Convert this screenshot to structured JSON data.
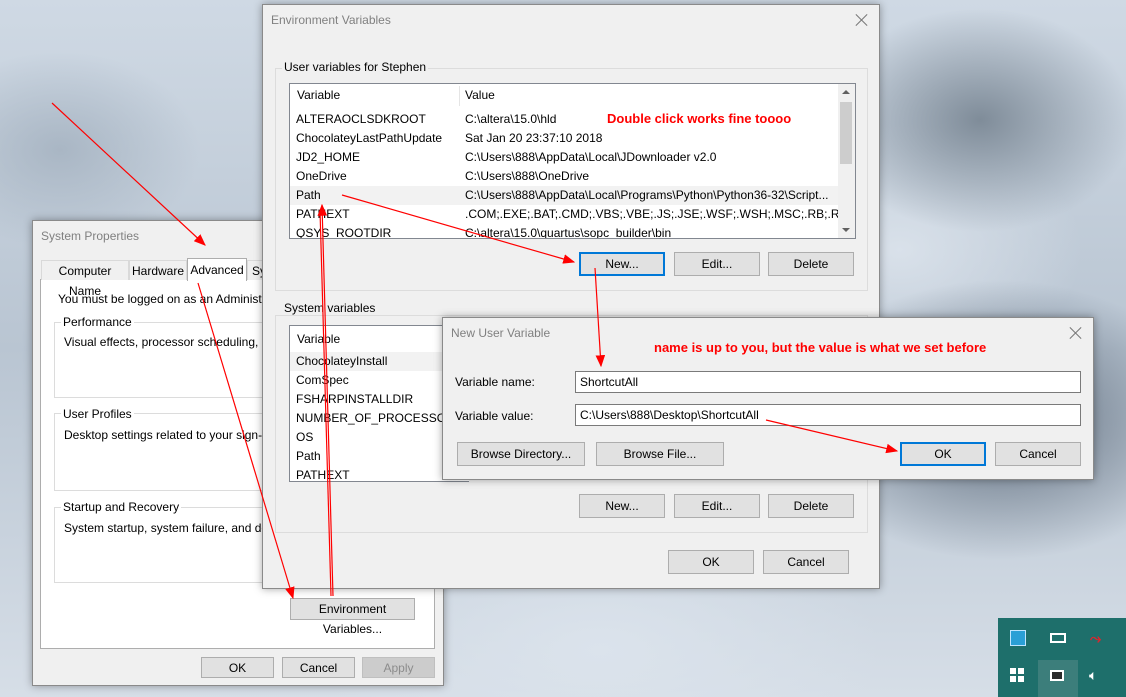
{
  "system_properties": {
    "title": "System Properties",
    "tabs": [
      "Computer Name",
      "Hardware",
      "Advanced",
      "Sy"
    ],
    "active_tab": "Advanced",
    "admin_note": "You must be logged on as an Administrator t",
    "performance": {
      "label": "Performance",
      "text": "Visual effects, processor scheduling, memo"
    },
    "user_profiles": {
      "label": "User Profiles",
      "text": "Desktop settings related to your sign-in"
    },
    "startup_recovery": {
      "label": "Startup and Recovery",
      "text": "System startup, system failure, and debugg"
    },
    "env_button": "Environment Variables...",
    "ok": "OK",
    "cancel": "Cancel",
    "apply": "Apply"
  },
  "env_vars": {
    "title": "Environment Variables",
    "user_group_label": "User variables for Stephen",
    "columns": [
      "Variable",
      "Value"
    ],
    "user_vars": [
      {
        "name": "ALTERAOCLSDKROOT",
        "value": "C:\\altera\\15.0\\hld"
      },
      {
        "name": "ChocolateyLastPathUpdate",
        "value": "Sat Jan 20 23:37:10 2018"
      },
      {
        "name": "JD2_HOME",
        "value": "C:\\Users\\888\\AppData\\Local\\JDownloader v2.0"
      },
      {
        "name": "OneDrive",
        "value": "C:\\Users\\888\\OneDrive"
      },
      {
        "name": "Path",
        "value": "C:\\Users\\888\\AppData\\Local\\Programs\\Python\\Python36-32\\Script..."
      },
      {
        "name": "PATHEXT",
        "value": ".COM;.EXE;.BAT;.CMD;.VBS;.VBE;.JS;.JSE;.WSF;.WSH;.MSC;.RB;.RBW;..."
      },
      {
        "name": "QSYS_ROOTDIR",
        "value": "C:\\altera\\15.0\\quartus\\sopc_builder\\bin"
      }
    ],
    "user_new": "New...",
    "user_edit": "Edit...",
    "user_delete": "Delete",
    "system_group_label": "System variables",
    "system_vars": [
      "ChocolateyInstall",
      "ComSpec",
      "FSHARPINSTALLDIR",
      "NUMBER_OF_PROCESSORS",
      "OS",
      "Path",
      "PATHEXT"
    ],
    "sys_new": "New...",
    "sys_edit": "Edit...",
    "sys_delete": "Delete",
    "ok": "OK",
    "cancel": "Cancel"
  },
  "new_user_var": {
    "title": "New User Variable",
    "name_label": "Variable name:",
    "name_value": "ShortcutAll",
    "value_label": "Variable value:",
    "value_value": "C:\\Users\\888\\Desktop\\ShortcutAll",
    "browse_dir": "Browse Directory...",
    "browse_file": "Browse File...",
    "ok": "OK",
    "cancel": "Cancel"
  },
  "annotations": {
    "double_click": "Double click works fine toooo",
    "name_note": "name is up to you, but the value is what we set before",
    "color": "#ff0000"
  },
  "tray": {
    "icons": [
      "app-icon",
      "battery-icon",
      "network-icon",
      "windows-icon",
      "display-icon",
      "volume-icon"
    ],
    "background": "#1e6f6b"
  }
}
